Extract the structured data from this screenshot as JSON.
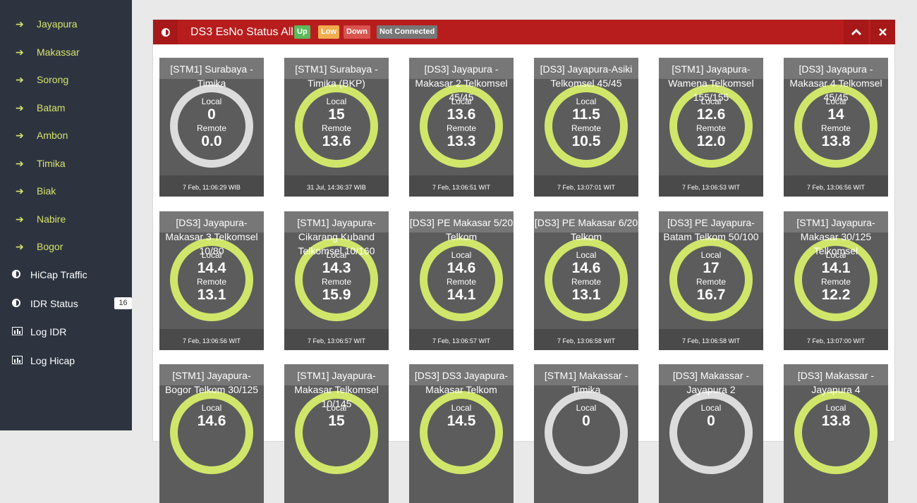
{
  "sidebar": {
    "sub_items": [
      "Jayapura",
      "Makassar",
      "Sorong",
      "Batam",
      "Ambon",
      "Timika",
      "Biak",
      "Nabire",
      "Bogor"
    ],
    "main_items": [
      {
        "label": "HiCap Traffic",
        "icon": "half-circle-icon"
      },
      {
        "label": "IDR Status",
        "icon": "half-circle-icon",
        "badge": "16"
      },
      {
        "label": "Log IDR",
        "icon": "bar-chart-icon"
      },
      {
        "label": "Log Hicap",
        "icon": "bar-chart-icon"
      }
    ]
  },
  "panel": {
    "title": "DS3 EsNo Status All",
    "tags": [
      {
        "label": "Up",
        "color": "#5cb85c"
      },
      {
        "label": "Low",
        "color": "#f0ad4e"
      },
      {
        "label": "Down",
        "color": "#d9534f"
      },
      {
        "label": "Not Connected",
        "color": "#777777"
      }
    ],
    "collapse_icon": "chevron-up-icon",
    "close_icon": "close-icon"
  },
  "labels": {
    "local": "Local",
    "remote": "Remote"
  },
  "colors": {
    "up": "#d0e66a",
    "not_connected": "#dcdcdc",
    "header": "#b81d1d",
    "sidebar_accent": "#d8e36a"
  },
  "tiles": [
    {
      "title": "[STM1] Surabaya - Timika",
      "local": "0",
      "remote": "0.0",
      "time": "7 Feb, 11:06:29 WIB",
      "status": "not-connected"
    },
    {
      "title": "[STM1] Surabaya - Timika (BKP)",
      "local": "15",
      "remote": "13.6",
      "time": "31 Jul, 14:36:37 WIB",
      "status": "up"
    },
    {
      "title": "[DS3] Jayapura - Makasar 2 Telkomsel 45/45",
      "local": "13.6",
      "remote": "13.3",
      "time": "7 Feb, 13:06:51 WIT",
      "status": "up"
    },
    {
      "title": "[DS3] Jayapura-Asiki Telkomsel 45/45",
      "local": "11.5",
      "remote": "10.5",
      "time": "7 Feb, 13:07:01 WIT",
      "status": "up"
    },
    {
      "title": "[STM1] Jayapura-Wamena Telkomsel 155/155",
      "local": "12.6",
      "remote": "12.0",
      "time": "7 Feb, 13:06:53 WIT",
      "status": "up"
    },
    {
      "title": "[DS3] Jayapura - Makasar 4 Telkomsel 45/45",
      "local": "14",
      "remote": "13.8",
      "time": "7 Feb, 13:06:56 WIT",
      "status": "up"
    },
    {
      "title": "[DS3] Jayapura-Makasar 3 Telkomsel 10/80",
      "local": "14.4",
      "remote": "13.1",
      "time": "7 Feb, 13:06:56 WIT",
      "status": "up"
    },
    {
      "title": "[STM1] Jayapura-Cikarang Kuband Telkomsel 10/160",
      "local": "14.3",
      "remote": "15.9",
      "time": "7 Feb, 13:06:57 WIT",
      "status": "up"
    },
    {
      "title": "[DS3] PE Makasar 5/20 Telkom",
      "local": "14.6",
      "remote": "14.1",
      "time": "7 Feb, 13:06:57 WIT",
      "status": "up"
    },
    {
      "title": "[DS3] PE Makasar 6/20 Telkom",
      "local": "14.6",
      "remote": "13.1",
      "time": "7 Feb, 13:06:58 WIT",
      "status": "up"
    },
    {
      "title": "[DS3] PE Jayapura-Batam Telkom 50/100",
      "local": "17",
      "remote": "16.7",
      "time": "7 Feb, 13:06:58 WIT",
      "status": "up"
    },
    {
      "title": "[STM1] Jayapura-Makasar 30/125 Telkomsel",
      "local": "14.1",
      "remote": "12.2",
      "time": "7 Feb, 13:07:00 WIT",
      "status": "up"
    },
    {
      "title": "[STM1] Jayapura-Bogor Telkom 30/125",
      "local": "14.6",
      "remote": "",
      "time": "",
      "status": "up"
    },
    {
      "title": "[STM1] Jayapura-Makasar Telkomsel 10/145",
      "local": "15",
      "remote": "",
      "time": "",
      "status": "up"
    },
    {
      "title": "[DS3] DS3 Jayapura-Makasar Telkom",
      "local": "14.5",
      "remote": "",
      "time": "",
      "status": "up"
    },
    {
      "title": "[STM1] Makassar - Timika",
      "local": "0",
      "remote": "",
      "time": "",
      "status": "not-connected"
    },
    {
      "title": "[DS3] Makassar - Jayapura 2",
      "local": "0",
      "remote": "",
      "time": "",
      "status": "not-connected"
    },
    {
      "title": "[DS3] Makassar - Jayapura 4",
      "local": "13.8",
      "remote": "",
      "time": "",
      "status": "up"
    }
  ]
}
